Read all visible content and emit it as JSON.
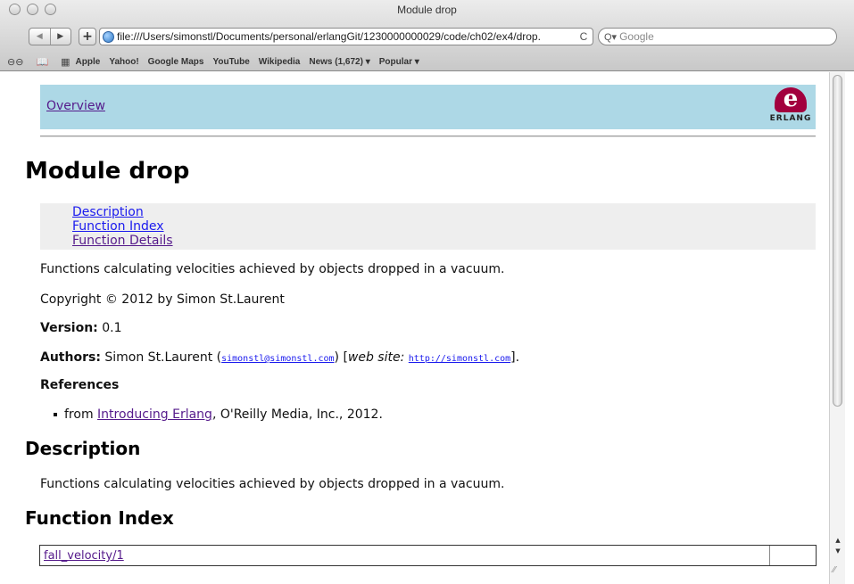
{
  "window": {
    "title": "Module drop"
  },
  "toolbar": {
    "back_icon": "◀",
    "forward_icon": "▶",
    "add_icon": "+",
    "url": "file:///Users/simonstl/Documents/personal/erlangGit/1230000000029/code/ch02/ex4/drop.",
    "reload_icon": "C",
    "search_placeholder": "Google",
    "search_icon": "Q▾"
  },
  "bookmarks": {
    "reader_icon": "⊖⊖",
    "book_icon": "📖",
    "grid_icon": "▦",
    "items": [
      "Apple",
      "Yahoo!",
      "Google Maps",
      "YouTube",
      "Wikipedia",
      "News (1,672) ▾",
      "Popular ▾"
    ]
  },
  "page": {
    "overview_link": "Overview",
    "logo_letter": "e",
    "logo_word": "ERLANG",
    "title": "Module drop",
    "toc": [
      "Description",
      "Function Index",
      "Function Details"
    ],
    "summary": "Functions calculating velocities achieved by objects dropped in a vacuum.",
    "copyright": "Copyright © 2012 by Simon St.Laurent",
    "version_label": "Version:",
    "version_value": "0.1",
    "authors_label": "Authors:",
    "authors_name": "Simon St.Laurent (",
    "authors_email": "simonstl@simonstl.com",
    "authors_mid": ") [",
    "website_label": "web site:",
    "website_url": "http://simonstl.com",
    "authors_end": "].",
    "references_heading": "References",
    "reference_prefix": "from ",
    "reference_link": "Introducing Erlang",
    "reference_suffix": ", O'Reilly Media, Inc., 2012.",
    "description_heading": "Description",
    "description_text": "Functions calculating velocities achieved by objects dropped in a vacuum.",
    "function_index_heading": "Function Index",
    "functions": [
      "fall_velocity/1"
    ]
  },
  "colors": {
    "navbar_bg": "#add8e6",
    "toc_bg": "#eeeeee",
    "link": "#1a1aee",
    "visited_link": "#551a8b",
    "erlang_logo": "#a2003e"
  }
}
